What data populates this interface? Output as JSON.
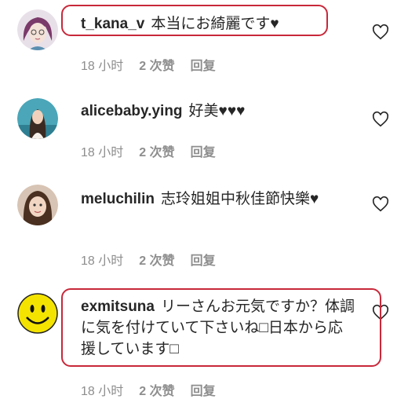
{
  "comments": [
    {
      "username": "t_kana_v",
      "text": "本当にお綺麗です♥",
      "time": "18 小时",
      "likes": "2 次赞",
      "reply": "回复",
      "avatar_icon": "cartoon-girl-avatar"
    },
    {
      "username": "alicebaby.ying",
      "text": "好美♥♥♥",
      "time": "18 小时",
      "likes": "2 次赞",
      "reply": "回复",
      "avatar_icon": "photo-avatar"
    },
    {
      "username": "meluchilin",
      "text": "志玲姐姐中秋佳節快樂♥",
      "time": "18 小时",
      "likes": "2 次赞",
      "reply": "回复",
      "avatar_icon": "photo-avatar"
    },
    {
      "username": "exmitsuna",
      "text": "リーさんお元気ですか？体調に気を付けていて下さいね□日本から応援しています□",
      "time": "18 小时",
      "likes": "2 次赞",
      "reply": "回复",
      "avatar_icon": "smiley-face-avatar"
    }
  ],
  "colors": {
    "highlight": "#c8283a",
    "meta_text": "#8e8e8e",
    "body_text": "#262626"
  },
  "icons": {
    "like": "heart-outline-icon"
  }
}
